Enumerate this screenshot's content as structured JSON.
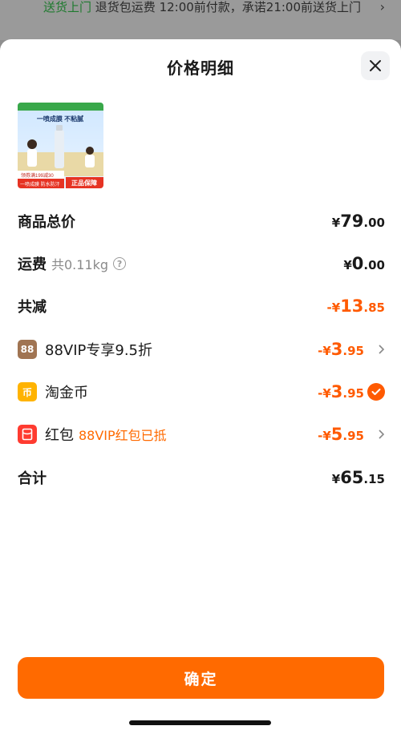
{
  "background": {
    "green_text": "送货上门",
    "text": "退货包运费 12:00前付款，承诺21:00前送货上门",
    "arrow": "›"
  },
  "sheet": {
    "title": "价格明细",
    "close_icon": "close-icon"
  },
  "product": {
    "banner_top": "一喷成膜 不粘腻",
    "price_tag": "领券满199减30",
    "bottom_left": "一喷成膜 防水防汗",
    "badge": "正品保障"
  },
  "rows": {
    "goods_total": {
      "label": "商品总价",
      "cur": "¥",
      "int": "79",
      "dec": ".00"
    },
    "shipping": {
      "label": "运费",
      "sub": "共0.11kg",
      "help_icon": "?",
      "cur": "¥",
      "int": "0",
      "dec": ".00"
    },
    "discount": {
      "label": "共减",
      "cur": "-¥",
      "int": "13",
      "dec": ".85"
    },
    "vip": {
      "icon_text": "88",
      "label": "88VIP专享9.5折",
      "cur": "-¥",
      "int": "3",
      "dec": ".95"
    },
    "coin": {
      "icon_text": "币",
      "label": "淘金币",
      "cur": "-¥",
      "int": "3",
      "dec": ".95"
    },
    "redpack": {
      "label": "红包",
      "note": "88VIP红包已抵",
      "cur": "-¥",
      "int": "5",
      "dec": ".95"
    },
    "total": {
      "label": "合计",
      "cur": "¥",
      "int": "65",
      "dec": ".15"
    }
  },
  "confirm_label": "确定",
  "colors": {
    "accent": "#ff6a00",
    "discount": "#ff5a00",
    "vip_icon": "#a07452",
    "coin_icon": "#ffb300",
    "redpack_icon": "#ff3b30"
  }
}
